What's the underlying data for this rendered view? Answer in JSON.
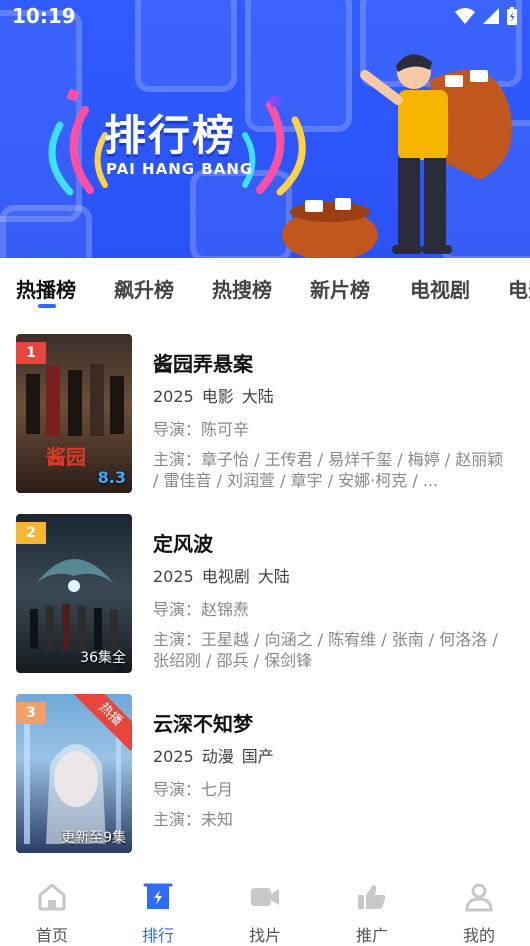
{
  "status_bar": {
    "time": "10:19"
  },
  "banner": {
    "title_cn": "排行榜",
    "title_en": "PAI HANG BANG"
  },
  "tabs": [
    {
      "label": "热播榜"
    },
    {
      "label": "飙升榜"
    },
    {
      "label": "热搜榜"
    },
    {
      "label": "新片榜"
    },
    {
      "label": "电视剧"
    },
    {
      "label": "电影"
    }
  ],
  "items": [
    {
      "rank": "1",
      "title": "酱园弄悬案",
      "year": "2025",
      "type": "电影",
      "region": "大陆",
      "director": "导演：陈可辛",
      "cast": "主演：章子怡 / 王传君 / 易烊千玺 / 梅婷 / 赵丽颖 / 雷佳音 / 刘润萱 / 章宇 / 安娜·柯克 / ...",
      "poster_caption": "8.3"
    },
    {
      "rank": "2",
      "title": "定风波",
      "year": "2025",
      "type": "电视剧",
      "region": "大陆",
      "director": "导演：赵锦焘",
      "cast": "主演：王星越 / 向涵之 / 陈宥维 / 张南 / 何洛洛 / 张绍刚 / 邵兵 / 保剑锋",
      "poster_caption": "36集全"
    },
    {
      "rank": "3",
      "title": "云深不知梦",
      "year": "2025",
      "type": "动漫",
      "region": "国产",
      "director": "导演：七月",
      "cast": "主演：未知",
      "poster_caption": "更新至9集",
      "badge": "热播"
    }
  ],
  "bottom_nav": [
    {
      "label": "首页",
      "icon": "home-icon"
    },
    {
      "label": "排行",
      "icon": "ranking-icon"
    },
    {
      "label": "找片",
      "icon": "video-camera-icon"
    },
    {
      "label": "推广",
      "icon": "thumbs-up-icon"
    },
    {
      "label": "我的",
      "icon": "user-icon"
    }
  ],
  "colors": {
    "accent": "#2f6bff",
    "banner": "#2f5bff",
    "rank1": "#e8453c",
    "rank2": "#f5b731",
    "rank3": "#f0a068"
  }
}
